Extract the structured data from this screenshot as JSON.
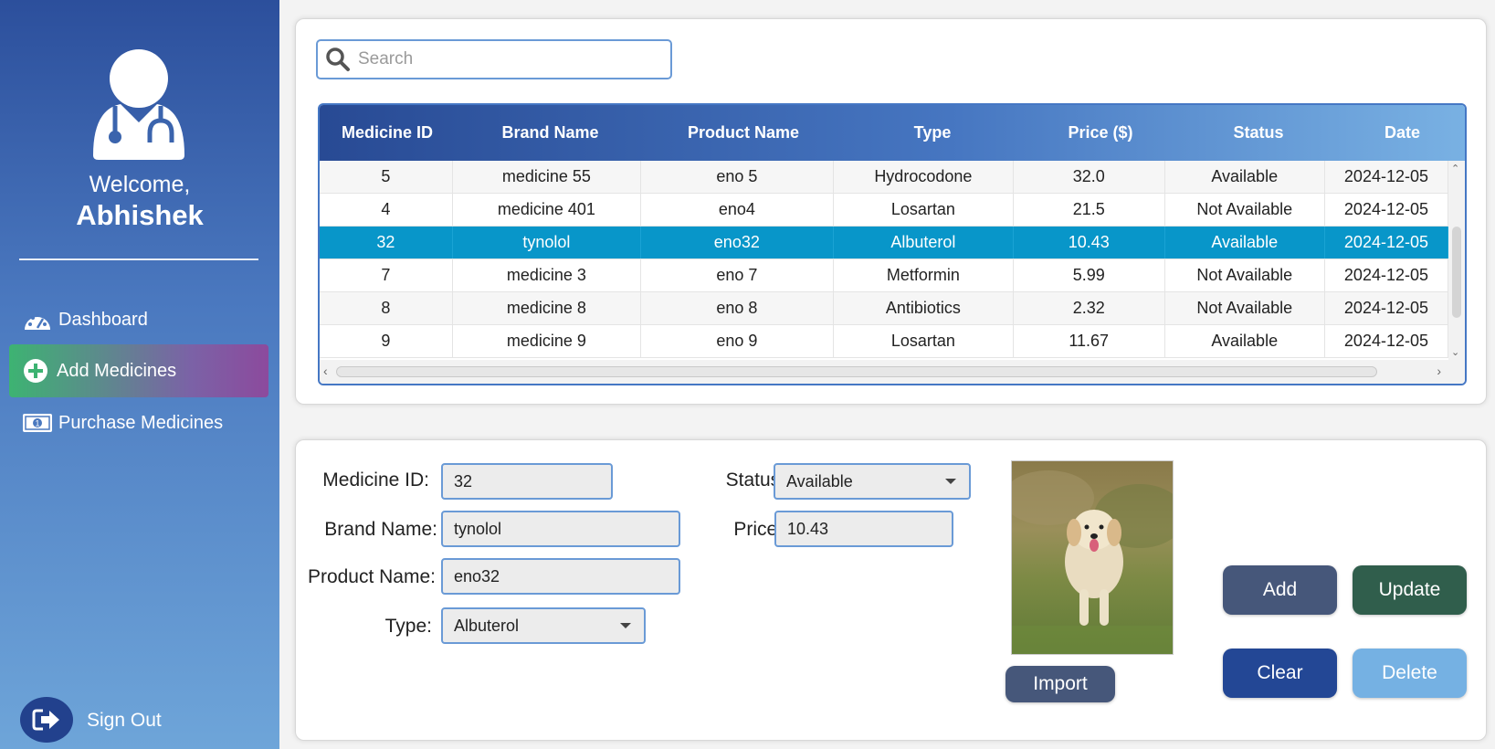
{
  "sidebar": {
    "welcome": "Welcome,",
    "username": "Abhishek",
    "nav": [
      {
        "label": "Dashboard",
        "icon": "dashboard-gauge-icon"
      },
      {
        "label": "Add Medicines",
        "icon": "plus-circle-icon",
        "active": true
      },
      {
        "label": "Purchase Medicines",
        "icon": "money-bill-icon"
      }
    ],
    "signout": "Sign Out"
  },
  "search": {
    "placeholder": "Search"
  },
  "table": {
    "columns": [
      "Medicine ID",
      "Brand Name",
      "Product Name",
      "Type",
      "Price ($)",
      "Status",
      "Date"
    ],
    "rows": [
      [
        "5",
        "medicine 55",
        "eno 5",
        "Hydrocodone",
        "32.0",
        "Available",
        "2024-12-05"
      ],
      [
        "4",
        "medicine 401",
        "eno4",
        "Losartan",
        "21.5",
        "Not Available",
        "2024-12-05"
      ],
      [
        "32",
        "tynolol",
        "eno32",
        "Albuterol",
        "10.43",
        "Available",
        "2024-12-05"
      ],
      [
        "7",
        "medicine 3",
        "eno 7",
        "Metformin",
        "5.99",
        "Not Available",
        "2024-12-05"
      ],
      [
        "8",
        "medicine 8",
        "eno 8",
        "Antibiotics",
        "2.32",
        "Not Available",
        "2024-12-05"
      ],
      [
        "9",
        "medicine 9",
        "eno 9",
        "Losartan",
        "11.67",
        "Available",
        "2024-12-05"
      ]
    ],
    "selected_index": 2
  },
  "form": {
    "medicine_id_label": "Medicine ID:",
    "medicine_id": "32",
    "brand_name_label": "Brand Name:",
    "brand_name": "tynolol",
    "product_name_label": "Product Name:",
    "product_name": "eno32",
    "type_label": "Type:",
    "type": "Albuterol",
    "status_label": "Status:",
    "status": "Available",
    "price_label": "Price:",
    "price": "10.43"
  },
  "buttons": {
    "import": "Import",
    "add": "Add",
    "update": "Update",
    "clear": "Clear",
    "delete": "Delete"
  },
  "colors": {
    "add": "#46577a",
    "update": "#305e4c",
    "clear": "#234795",
    "delete": "#75b1e3",
    "import": "#46577a",
    "selected_row": "#0896c9"
  }
}
